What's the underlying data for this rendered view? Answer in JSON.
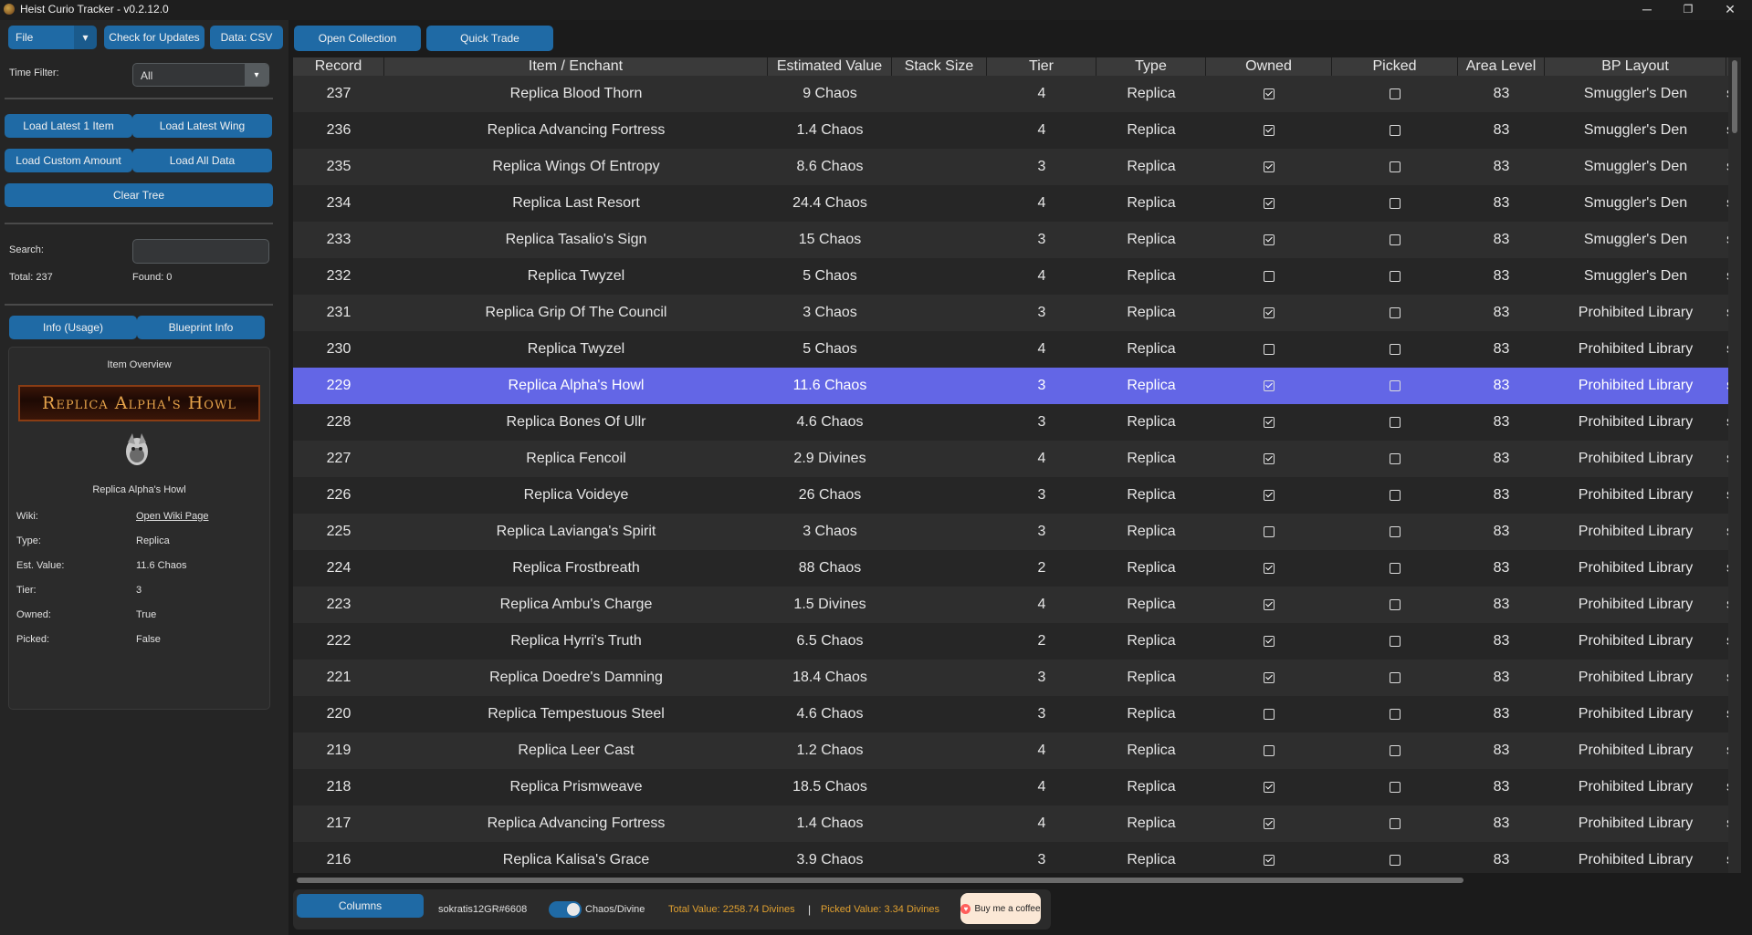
{
  "window": {
    "title": "Heist Curio Tracker - v0.2.12.0",
    "controls": {
      "minimize": "─",
      "maximize": "❐",
      "close": "✕"
    }
  },
  "toolbar": {
    "file_menu": "File",
    "check_updates": "Check for Updates",
    "data_csv": "Data: CSV",
    "open_collection": "Open Collection",
    "quick_trade": "Quick Trade"
  },
  "sidebar": {
    "time_filter_label": "Time Filter:",
    "time_filter_value": "All",
    "load_latest_item": "Load Latest 1 Item",
    "load_latest_wing": "Load Latest Wing",
    "load_custom_amount": "Load Custom Amount",
    "load_all_data": "Load All Data",
    "clear_tree": "Clear Tree",
    "search_label": "Search:",
    "search_value": "",
    "total": "Total: 237",
    "found": "Found: 0",
    "info_usage": "Info (Usage)",
    "blueprint_info": "Blueprint Info",
    "overview": {
      "title": "Item Overview",
      "banner_text": "Replica Alpha's Howl",
      "item_name": "Replica Alpha's Howl",
      "fields": [
        {
          "label": "Wiki:",
          "value": "Open Wiki Page",
          "link": true
        },
        {
          "label": "Type:",
          "value": "Replica"
        },
        {
          "label": "Est. Value:",
          "value": "11.6 Chaos"
        },
        {
          "label": "Tier:",
          "value": "3"
        },
        {
          "label": "Owned:",
          "value": "True"
        },
        {
          "label": "Picked:",
          "value": "False"
        }
      ]
    }
  },
  "table": {
    "columns": [
      "Record",
      "Item / Enchant",
      "Estimated Value",
      "Stack Size",
      "Tier",
      "Type",
      "Owned",
      "Picked",
      "Area Level",
      "BP Layout",
      ""
    ],
    "selected_record": "229",
    "rows": [
      {
        "record": "237",
        "item": "Replica Blood Thorn",
        "value": "9 Chaos",
        "stack": "",
        "tier": "4",
        "type": "Replica",
        "owned": true,
        "picked": false,
        "area": "83",
        "layout": "Smuggler's Den",
        "extra": "s"
      },
      {
        "record": "236",
        "item": "Replica Advancing Fortress",
        "value": "1.4 Chaos",
        "stack": "",
        "tier": "4",
        "type": "Replica",
        "owned": true,
        "picked": false,
        "area": "83",
        "layout": "Smuggler's Den",
        "extra": "s"
      },
      {
        "record": "235",
        "item": "Replica Wings Of Entropy",
        "value": "8.6 Chaos",
        "stack": "",
        "tier": "3",
        "type": "Replica",
        "owned": true,
        "picked": false,
        "area": "83",
        "layout": "Smuggler's Den",
        "extra": "s"
      },
      {
        "record": "234",
        "item": "Replica Last Resort",
        "value": "24.4 Chaos",
        "stack": "",
        "tier": "4",
        "type": "Replica",
        "owned": true,
        "picked": false,
        "area": "83",
        "layout": "Smuggler's Den",
        "extra": "s"
      },
      {
        "record": "233",
        "item": "Replica Tasalio's Sign",
        "value": "15 Chaos",
        "stack": "",
        "tier": "3",
        "type": "Replica",
        "owned": true,
        "picked": false,
        "area": "83",
        "layout": "Smuggler's Den",
        "extra": "s"
      },
      {
        "record": "232",
        "item": "Replica Twyzel",
        "value": "5 Chaos",
        "stack": "",
        "tier": "4",
        "type": "Replica",
        "owned": false,
        "picked": false,
        "area": "83",
        "layout": "Smuggler's Den",
        "extra": "s"
      },
      {
        "record": "231",
        "item": "Replica Grip Of The Council",
        "value": "3 Chaos",
        "stack": "",
        "tier": "3",
        "type": "Replica",
        "owned": true,
        "picked": false,
        "area": "83",
        "layout": "Prohibited Library",
        "extra": "s"
      },
      {
        "record": "230",
        "item": "Replica Twyzel",
        "value": "5 Chaos",
        "stack": "",
        "tier": "4",
        "type": "Replica",
        "owned": false,
        "picked": false,
        "area": "83",
        "layout": "Prohibited Library",
        "extra": "s"
      },
      {
        "record": "229",
        "item": "Replica Alpha's Howl",
        "value": "11.6 Chaos",
        "stack": "",
        "tier": "3",
        "type": "Replica",
        "owned": true,
        "picked": false,
        "area": "83",
        "layout": "Prohibited Library",
        "extra": "s"
      },
      {
        "record": "228",
        "item": "Replica Bones Of Ullr",
        "value": "4.6 Chaos",
        "stack": "",
        "tier": "3",
        "type": "Replica",
        "owned": true,
        "picked": false,
        "area": "83",
        "layout": "Prohibited Library",
        "extra": "s"
      },
      {
        "record": "227",
        "item": "Replica Fencoil",
        "value": "2.9 Divines",
        "stack": "",
        "tier": "4",
        "type": "Replica",
        "owned": true,
        "picked": false,
        "area": "83",
        "layout": "Prohibited Library",
        "extra": "s"
      },
      {
        "record": "226",
        "item": "Replica Voideye",
        "value": "26 Chaos",
        "stack": "",
        "tier": "3",
        "type": "Replica",
        "owned": true,
        "picked": false,
        "area": "83",
        "layout": "Prohibited Library",
        "extra": "s"
      },
      {
        "record": "225",
        "item": "Replica Lavianga's Spirit",
        "value": "3 Chaos",
        "stack": "",
        "tier": "3",
        "type": "Replica",
        "owned": false,
        "picked": false,
        "area": "83",
        "layout": "Prohibited Library",
        "extra": "s"
      },
      {
        "record": "224",
        "item": "Replica Frostbreath",
        "value": "88 Chaos",
        "stack": "",
        "tier": "2",
        "type": "Replica",
        "owned": true,
        "picked": false,
        "area": "83",
        "layout": "Prohibited Library",
        "extra": "s"
      },
      {
        "record": "223",
        "item": "Replica Ambu's Charge",
        "value": "1.5 Divines",
        "stack": "",
        "tier": "4",
        "type": "Replica",
        "owned": true,
        "picked": false,
        "area": "83",
        "layout": "Prohibited Library",
        "extra": "s"
      },
      {
        "record": "222",
        "item": "Replica Hyrri's Truth",
        "value": "6.5 Chaos",
        "stack": "",
        "tier": "2",
        "type": "Replica",
        "owned": true,
        "picked": false,
        "area": "83",
        "layout": "Prohibited Library",
        "extra": "s"
      },
      {
        "record": "221",
        "item": "Replica Doedre's Damning",
        "value": "18.4 Chaos",
        "stack": "",
        "tier": "3",
        "type": "Replica",
        "owned": true,
        "picked": false,
        "area": "83",
        "layout": "Prohibited Library",
        "extra": "s"
      },
      {
        "record": "220",
        "item": "Replica Tempestuous Steel",
        "value": "4.6 Chaos",
        "stack": "",
        "tier": "3",
        "type": "Replica",
        "owned": false,
        "picked": false,
        "area": "83",
        "layout": "Prohibited Library",
        "extra": "s"
      },
      {
        "record": "219",
        "item": "Replica Leer Cast",
        "value": "1.2 Chaos",
        "stack": "",
        "tier": "4",
        "type": "Replica",
        "owned": false,
        "picked": false,
        "area": "83",
        "layout": "Prohibited Library",
        "extra": "s"
      },
      {
        "record": "218",
        "item": "Replica Prismweave",
        "value": "18.5 Chaos",
        "stack": "",
        "tier": "4",
        "type": "Replica",
        "owned": true,
        "picked": false,
        "area": "83",
        "layout": "Prohibited Library",
        "extra": "s"
      },
      {
        "record": "217",
        "item": "Replica Advancing Fortress",
        "value": "1.4 Chaos",
        "stack": "",
        "tier": "4",
        "type": "Replica",
        "owned": true,
        "picked": false,
        "area": "83",
        "layout": "Prohibited Library",
        "extra": "s"
      },
      {
        "record": "216",
        "item": "Replica Kalisa's Grace",
        "value": "3.9 Chaos",
        "stack": "",
        "tier": "3",
        "type": "Replica",
        "owned": true,
        "picked": false,
        "area": "83",
        "layout": "Prohibited Library",
        "extra": "s"
      }
    ]
  },
  "bottom": {
    "columns_button": "Columns",
    "user": "sokratis12GR#6608",
    "currency_toggle": "Chaos/Divine",
    "total_value": "Total Value: 2258.74 Divines",
    "divider": "|",
    "picked_value": "Picked Value: 3.34 Divines",
    "coffee": "Buy me a coffee"
  },
  "colors": {
    "accent": "#1f6aa5",
    "selected_row": "#6366e6",
    "gold": "#e0a030"
  }
}
